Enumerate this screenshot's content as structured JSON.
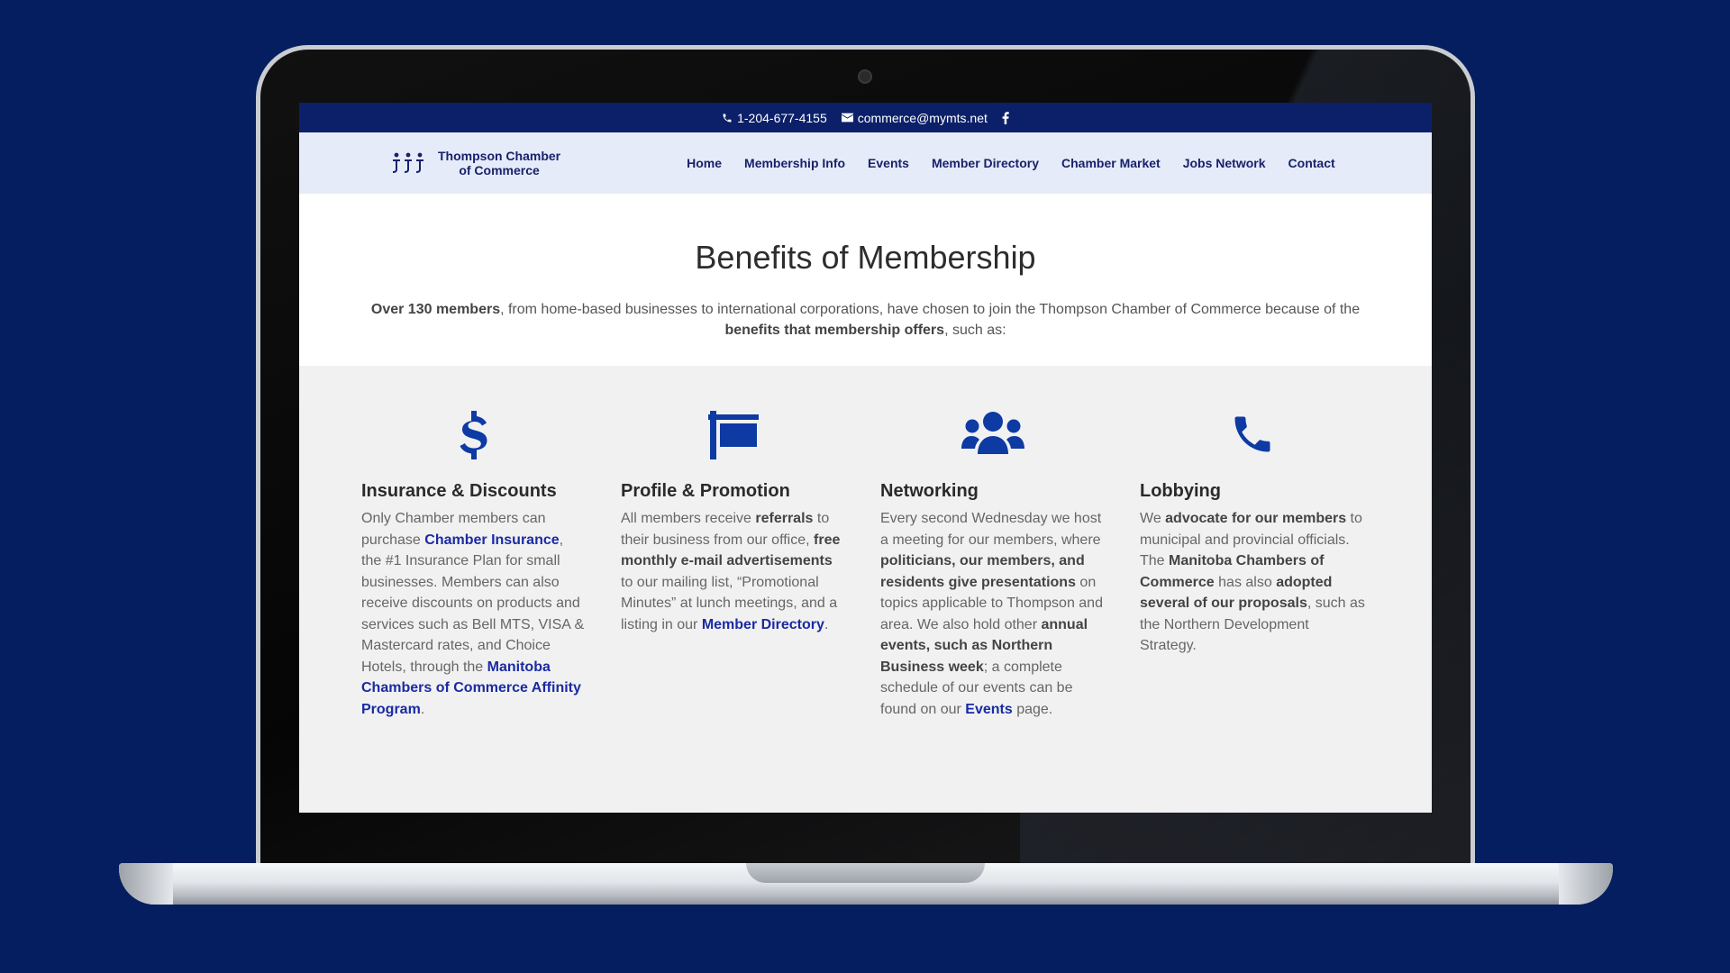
{
  "topbar": {
    "phone": "1-204-677-4155",
    "email": "commerce@mymts.net"
  },
  "logo": {
    "line1": "Thompson Chamber",
    "line2": "of Commerce"
  },
  "nav": [
    "Home",
    "Membership Info",
    "Events",
    "Member Directory",
    "Chamber Market",
    "Jobs Network",
    "Contact"
  ],
  "hero": {
    "title": "Benefits of Membership",
    "p1_bold": "Over 130 members",
    "p1_text": ", from home-based businesses to international corporations, have chosen to join the Thompson Chamber of Commerce because of the ",
    "p1_bold2": "benefits that membership offers",
    "p1_end": ", such as:"
  },
  "benefits": [
    {
      "icon": "dollar-icon",
      "title": "Insurance & Discounts",
      "t1": "Only Chamber members can purchase ",
      "l1": "Chamber Insurance",
      "t2": ", the #1 Insurance Plan for small businesses. Members can also receive discounts on products and services such as Bell MTS, VISA & Mastercard rates, and Choice Hotels, through the ",
      "l2": "Manitoba Chambers of Commerce Affinity Program",
      "t3": "."
    },
    {
      "icon": "signboard-icon",
      "title": "Profile & Promotion",
      "t1": "All members receive ",
      "b1": "referrals",
      "t2": " to their business from our office, ",
      "b2": "free monthly e-mail advertisements",
      "t3": " to our mailing list, “Promotional Minutes” at lunch meetings, and a listing in our ",
      "l1": "Member Directory",
      "t4": "."
    },
    {
      "icon": "group-icon",
      "title": "Networking",
      "t1": "Every second Wednesday we host a meeting for our members, where ",
      "b1": "politicians, our members, and residents give presentations",
      "t2": " on topics applicable to Thompson and area. We also hold other ",
      "b2": "annual events, such as Northern Business week",
      "t3": "; a complete schedule of our events can be found on our ",
      "l1": "Events",
      "t4": " page."
    },
    {
      "icon": "phone-icon",
      "title": "Lobbying",
      "t1": "We ",
      "b1": "advocate for our members",
      "t2": " to municipal and provincial officials.  The ",
      "b2": "Manitoba Chambers of Commerce",
      "t3": " has also ",
      "b3": "adopted several of our proposals",
      "t4": ", such as the Northern Development Strategy."
    }
  ]
}
